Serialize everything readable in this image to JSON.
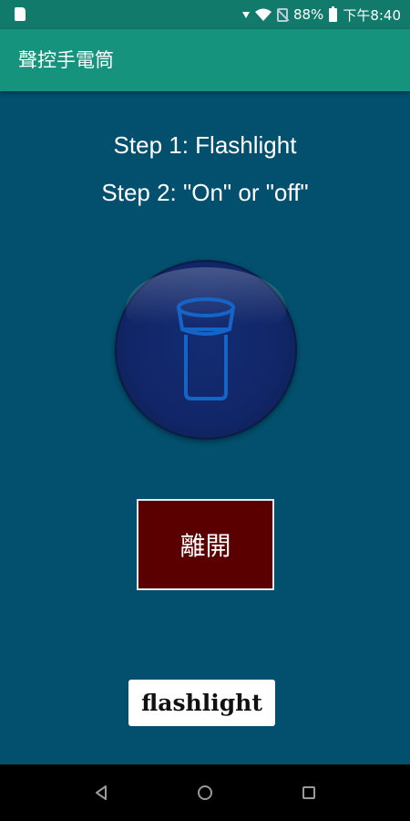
{
  "status_bar": {
    "battery": "88%",
    "time": "下午8:40",
    "icons": [
      "sd-card-icon",
      "download-arrow-icon",
      "wifi-icon",
      "no-sim-icon",
      "battery-icon"
    ]
  },
  "app_bar": {
    "title": "聲控手電筒"
  },
  "instructions": {
    "step1": "Step 1:  Flashlight",
    "step2": "Step 2: \"On\" or \"off\""
  },
  "flash_button": {
    "icon": "flashlight-icon"
  },
  "exit_button": {
    "label": "離開"
  },
  "ad_banner": {
    "text": "flashlight"
  },
  "nav_bar": {
    "buttons": [
      "back-icon",
      "home-icon",
      "recents-icon"
    ]
  },
  "colors": {
    "background": "#02506e",
    "status_bar": "#117a6b",
    "app_bar": "#16937d",
    "exit_button": "#5b0000",
    "flash_button": "#112667",
    "flashlight_stroke": "#1565c8"
  }
}
